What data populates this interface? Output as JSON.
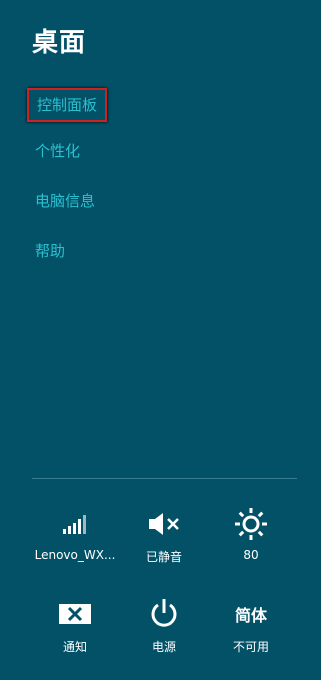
{
  "panel": {
    "title": "桌面"
  },
  "menu": {
    "items": [
      {
        "label": "控制面板"
      },
      {
        "label": "个性化"
      },
      {
        "label": "电脑信息"
      },
      {
        "label": "帮助"
      }
    ]
  },
  "quick_settings": {
    "network_label": "Lenovo_WX...",
    "volume_label": "已静音",
    "brightness_value": "80",
    "notifications_label": "通知",
    "power_label": "电源",
    "language_glyph": "简体",
    "language_label": "不可用"
  },
  "colors": {
    "background": "#025167",
    "link": "#2cc0cf",
    "selection_border": "#cc2222"
  }
}
